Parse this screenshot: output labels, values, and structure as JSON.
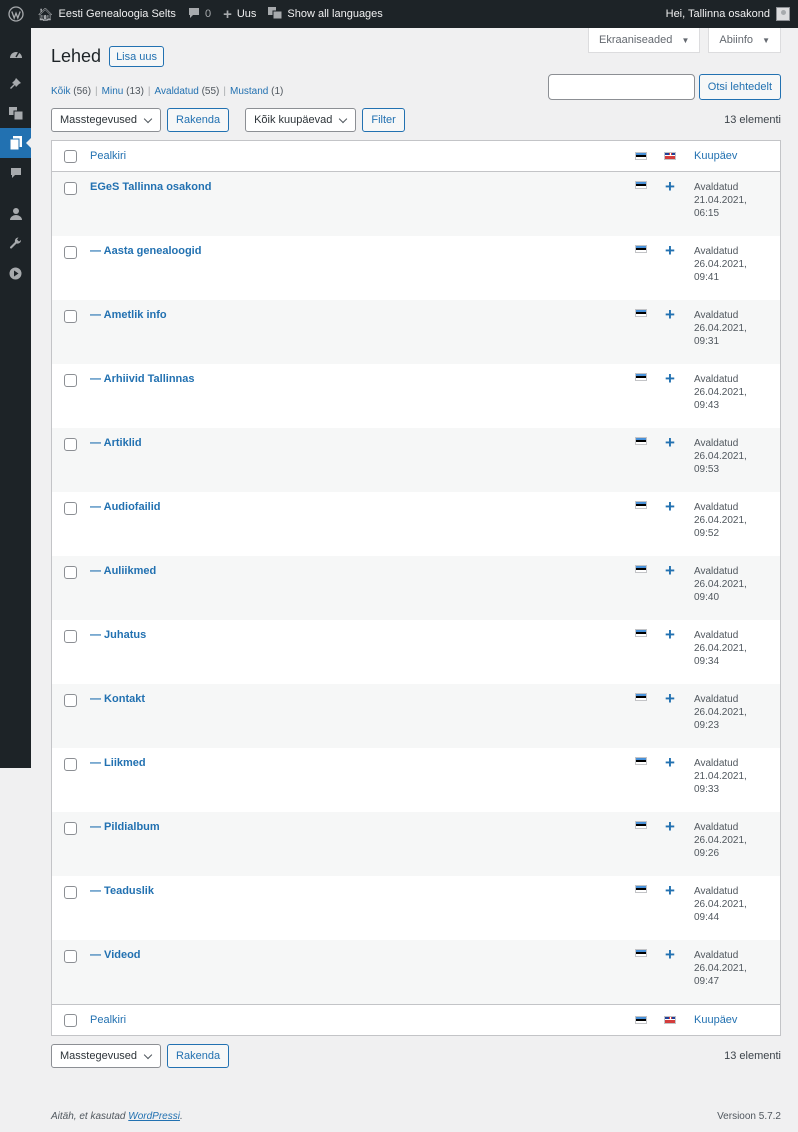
{
  "adminbar": {
    "site_name": "Eesti Genealoogia Selts",
    "comments_count": "0",
    "new_label": "Uus",
    "languages_label": "Show all languages",
    "greeting": "Hei, Tallinna osakond"
  },
  "screen_meta": {
    "screen_options": "Ekraaniseaded",
    "help": "Abiinfo"
  },
  "page": {
    "title": "Lehed",
    "add_new": "Lisa uus"
  },
  "views": [
    {
      "label": "Kõik",
      "count": "(56)"
    },
    {
      "label": "Minu",
      "count": "(13)"
    },
    {
      "label": "Avaldatud",
      "count": "(55)"
    },
    {
      "label": "Mustand",
      "count": "(1)"
    }
  ],
  "search": {
    "button": "Otsi lehtedelt",
    "value": ""
  },
  "tablenav": {
    "bulk_actions": "Masstegevused",
    "apply": "Rakenda",
    "dates": "Kõik kuupäevad",
    "filter": "Filter",
    "displaying": "13 elementi"
  },
  "columns": {
    "title": "Pealkiri",
    "date": "Kuupäev"
  },
  "rows": [
    {
      "title": "EGeS Tallinna osakond",
      "status": "Avaldatud",
      "date": "21.04.2021,",
      "time": "06:15"
    },
    {
      "title": "— Aasta genealoogid",
      "status": "Avaldatud",
      "date": "26.04.2021,",
      "time": "09:41"
    },
    {
      "title": "— Ametlik info",
      "status": "Avaldatud",
      "date": "26.04.2021,",
      "time": "09:31"
    },
    {
      "title": "— Arhiivid Tallinnas",
      "status": "Avaldatud",
      "date": "26.04.2021,",
      "time": "09:43"
    },
    {
      "title": "— Artiklid",
      "status": "Avaldatud",
      "date": "26.04.2021,",
      "time": "09:53"
    },
    {
      "title": "— Audiofailid",
      "status": "Avaldatud",
      "date": "26.04.2021,",
      "time": "09:52"
    },
    {
      "title": "— Auliikmed",
      "status": "Avaldatud",
      "date": "26.04.2021,",
      "time": "09:40"
    },
    {
      "title": "— Juhatus",
      "status": "Avaldatud",
      "date": "26.04.2021,",
      "time": "09:34"
    },
    {
      "title": "— Kontakt",
      "status": "Avaldatud",
      "date": "26.04.2021,",
      "time": "09:23"
    },
    {
      "title": "— Liikmed",
      "status": "Avaldatud",
      "date": "21.04.2021,",
      "time": "09:33"
    },
    {
      "title": "— Pildialbum",
      "status": "Avaldatud",
      "date": "26.04.2021,",
      "time": "09:26"
    },
    {
      "title": "— Teaduslik",
      "status": "Avaldatud",
      "date": "26.04.2021,",
      "time": "09:44"
    },
    {
      "title": "— Videod",
      "status": "Avaldatud",
      "date": "26.04.2021,",
      "time": "09:47"
    }
  ],
  "footer": {
    "thanks_prefix": "Aitäh, et kasutad ",
    "wordpress_link": "WordPressi",
    "thanks_suffix": ".",
    "version": "Versioon 5.7.2"
  },
  "icons": {
    "wp_logo": "wordpress-logo-icon",
    "home": "home-icon",
    "comments": "comment-icon",
    "new": "plus-icon",
    "languages": "translate-icon",
    "menu": [
      "dashboard-icon",
      "pin-icon",
      "translate-icon",
      "pages-icon",
      "comment-icon",
      "user-icon",
      "wrench-icon",
      "play-icon"
    ]
  },
  "colors": {
    "accent": "#2271b1",
    "adminbar": "#1d2327",
    "background": "#f0f0f1"
  }
}
